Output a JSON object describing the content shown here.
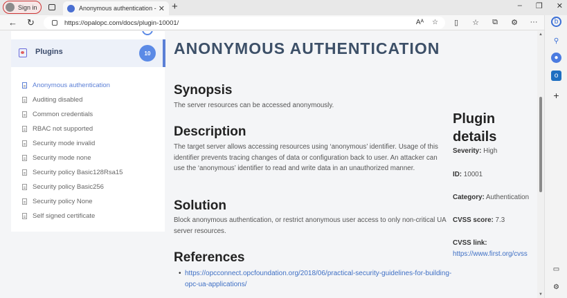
{
  "browser": {
    "profile_label": "Sign in",
    "tab_title": "Anonymous authentication - Opc",
    "url": "https://opalopc.com/docs/plugin-10001/",
    "icons": [
      "back-icon",
      "refresh-icon",
      "lock-icon",
      "read-aloud-icon",
      "favorite-icon",
      "split-screen-icon",
      "favorites-icon",
      "collections-icon",
      "extensions-icon",
      "more-icon"
    ]
  },
  "sidebar": {
    "header_label": "Plugins",
    "badge": "10",
    "items": [
      {
        "label": "Anonymous authentication",
        "active": true
      },
      {
        "label": "Auditing disabled"
      },
      {
        "label": "Common credentials"
      },
      {
        "label": "RBAC not supported"
      },
      {
        "label": "Security mode invalid"
      },
      {
        "label": "Security mode none"
      },
      {
        "label": "Security policy Basic128Rsa15"
      },
      {
        "label": "Security policy Basic256"
      },
      {
        "label": "Security policy None"
      },
      {
        "label": "Self signed certificate"
      }
    ]
  },
  "main": {
    "title": "ANONYMOUS AUTHENTICATION",
    "synopsis_heading": "Synopsis",
    "synopsis_text": "The server resources can be accessed anonymously.",
    "description_heading": "Description",
    "description_text": "The target server allows accessing resources using ‘anonymous’ identifier. Usage of this identifier prevents tracing changes of data or configuration back to user. An attacker can use the ‘anonymous’ identifier to read and write data in an unauthorized manner.",
    "solution_heading": "Solution",
    "solution_text": "Block anonymous authentication, or restrict anonymous user access to only non-critical UA server resources.",
    "references_heading": "References",
    "references_link": "https://opcconnect.opcfoundation.org/2018/06/practical-security-guidelines-for-building-opc-ua-applications/"
  },
  "details": {
    "title": "Plugin details",
    "severity_label": "Severity:",
    "severity_value": "High",
    "id_label": "ID:",
    "id_value": "10001",
    "category_label": "Category:",
    "category_value": "Authentication",
    "cvss_score_label": "CVSS score:",
    "cvss_score_value": "7.3",
    "cvss_link_label": "CVSS link:",
    "cvss_link_value": "https://www.first.org/cvss"
  }
}
